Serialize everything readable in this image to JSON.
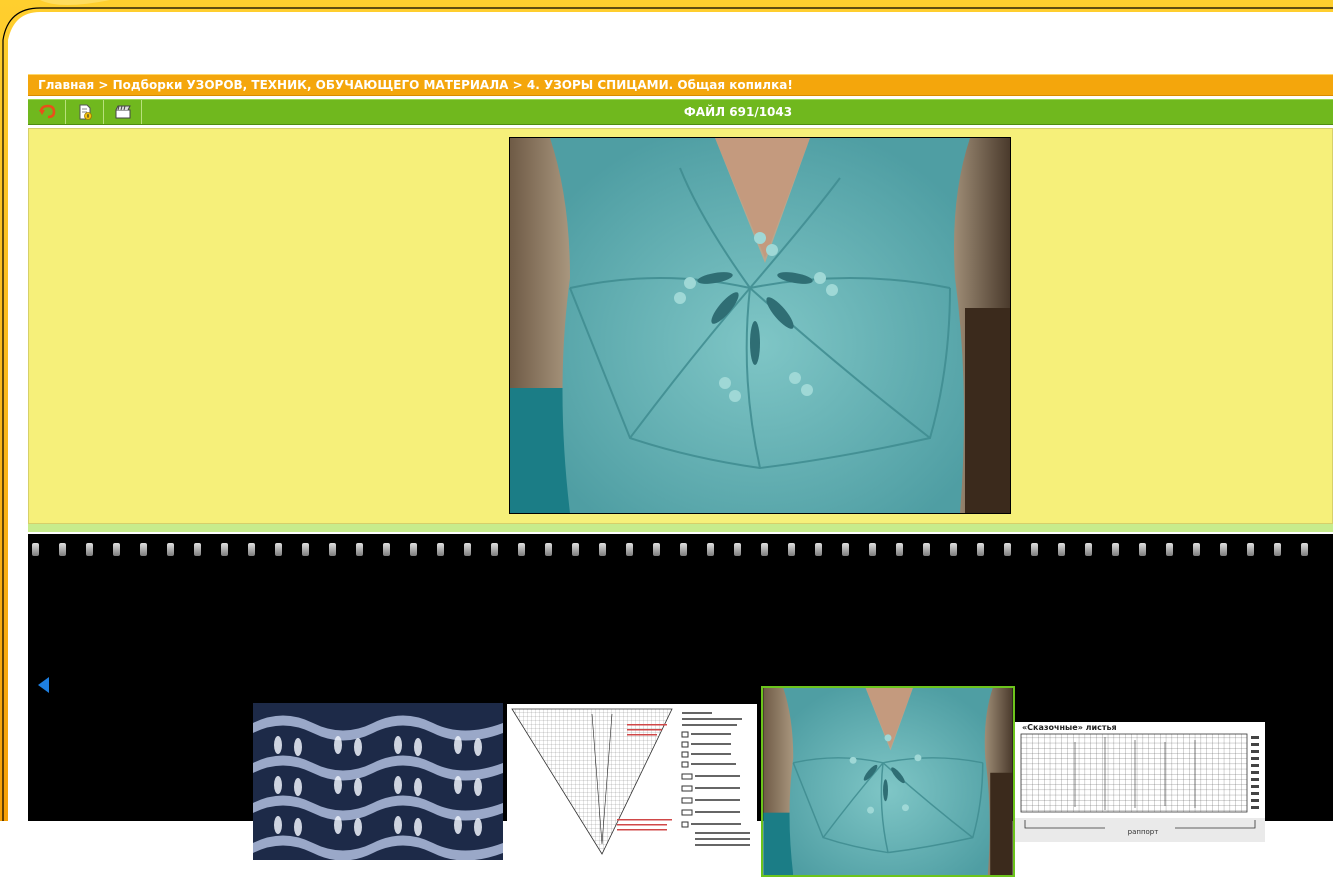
{
  "breadcrumb": {
    "text": "Главная > Подборки УЗОРОВ, ТЕХНИК, ОБУЧАЮЩЕГО МАТЕРИАЛА > 4. УЗОРЫ СПИЦАМИ. Общая копилка!"
  },
  "toolbar": {
    "file_counter": "ФАЙЛ 691/1043",
    "buttons": [
      {
        "icon": "return-icon"
      },
      {
        "icon": "file-info-icon"
      },
      {
        "icon": "slideshow-icon"
      }
    ]
  },
  "main_image": {
    "description_icon": "knitted-sweater-photo"
  },
  "filmstrip": {
    "prev_icon": "prev-arrow-icon",
    "thumbnails": [
      {
        "icon": "lace-pattern-thumbnail"
      },
      {
        "icon": "knitting-chart-thumbnail"
      },
      {
        "icon": "knitted-sweater-thumbnail",
        "selected": true
      },
      {
        "icon": "leaves-chart-thumbnail",
        "title": "«Сказочные» листья",
        "footer": "раппорт"
      }
    ]
  },
  "colors": {
    "orange": "#f4a60c",
    "green": "#70b81e",
    "yellow_panel": "#f6f07a",
    "selected_border": "#6cc41c"
  }
}
